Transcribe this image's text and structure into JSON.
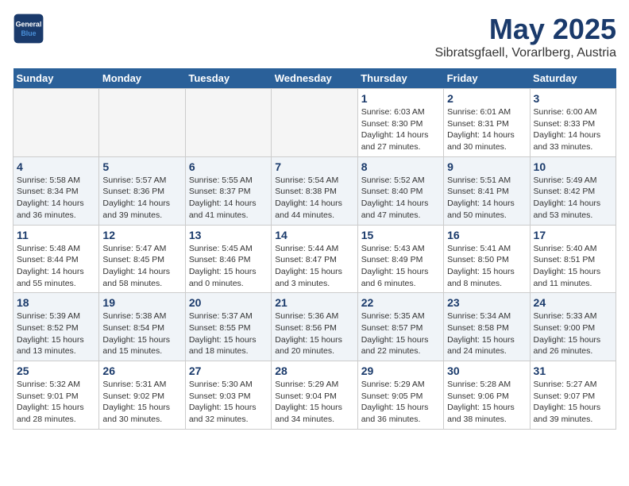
{
  "header": {
    "logo_text_general": "General",
    "logo_text_blue": "Blue",
    "month_title": "May 2025",
    "location": "Sibratsgfaell, Vorarlberg, Austria"
  },
  "weekdays": [
    "Sunday",
    "Monday",
    "Tuesday",
    "Wednesday",
    "Thursday",
    "Friday",
    "Saturday"
  ],
  "weeks": [
    [
      {
        "day": "",
        "info": ""
      },
      {
        "day": "",
        "info": ""
      },
      {
        "day": "",
        "info": ""
      },
      {
        "day": "",
        "info": ""
      },
      {
        "day": "1",
        "info": "Sunrise: 6:03 AM\nSunset: 8:30 PM\nDaylight: 14 hours\nand 27 minutes."
      },
      {
        "day": "2",
        "info": "Sunrise: 6:01 AM\nSunset: 8:31 PM\nDaylight: 14 hours\nand 30 minutes."
      },
      {
        "day": "3",
        "info": "Sunrise: 6:00 AM\nSunset: 8:33 PM\nDaylight: 14 hours\nand 33 minutes."
      }
    ],
    [
      {
        "day": "4",
        "info": "Sunrise: 5:58 AM\nSunset: 8:34 PM\nDaylight: 14 hours\nand 36 minutes."
      },
      {
        "day": "5",
        "info": "Sunrise: 5:57 AM\nSunset: 8:36 PM\nDaylight: 14 hours\nand 39 minutes."
      },
      {
        "day": "6",
        "info": "Sunrise: 5:55 AM\nSunset: 8:37 PM\nDaylight: 14 hours\nand 41 minutes."
      },
      {
        "day": "7",
        "info": "Sunrise: 5:54 AM\nSunset: 8:38 PM\nDaylight: 14 hours\nand 44 minutes."
      },
      {
        "day": "8",
        "info": "Sunrise: 5:52 AM\nSunset: 8:40 PM\nDaylight: 14 hours\nand 47 minutes."
      },
      {
        "day": "9",
        "info": "Sunrise: 5:51 AM\nSunset: 8:41 PM\nDaylight: 14 hours\nand 50 minutes."
      },
      {
        "day": "10",
        "info": "Sunrise: 5:49 AM\nSunset: 8:42 PM\nDaylight: 14 hours\nand 53 minutes."
      }
    ],
    [
      {
        "day": "11",
        "info": "Sunrise: 5:48 AM\nSunset: 8:44 PM\nDaylight: 14 hours\nand 55 minutes."
      },
      {
        "day": "12",
        "info": "Sunrise: 5:47 AM\nSunset: 8:45 PM\nDaylight: 14 hours\nand 58 minutes."
      },
      {
        "day": "13",
        "info": "Sunrise: 5:45 AM\nSunset: 8:46 PM\nDaylight: 15 hours\nand 0 minutes."
      },
      {
        "day": "14",
        "info": "Sunrise: 5:44 AM\nSunset: 8:47 PM\nDaylight: 15 hours\nand 3 minutes."
      },
      {
        "day": "15",
        "info": "Sunrise: 5:43 AM\nSunset: 8:49 PM\nDaylight: 15 hours\nand 6 minutes."
      },
      {
        "day": "16",
        "info": "Sunrise: 5:41 AM\nSunset: 8:50 PM\nDaylight: 15 hours\nand 8 minutes."
      },
      {
        "day": "17",
        "info": "Sunrise: 5:40 AM\nSunset: 8:51 PM\nDaylight: 15 hours\nand 11 minutes."
      }
    ],
    [
      {
        "day": "18",
        "info": "Sunrise: 5:39 AM\nSunset: 8:52 PM\nDaylight: 15 hours\nand 13 minutes."
      },
      {
        "day": "19",
        "info": "Sunrise: 5:38 AM\nSunset: 8:54 PM\nDaylight: 15 hours\nand 15 minutes."
      },
      {
        "day": "20",
        "info": "Sunrise: 5:37 AM\nSunset: 8:55 PM\nDaylight: 15 hours\nand 18 minutes."
      },
      {
        "day": "21",
        "info": "Sunrise: 5:36 AM\nSunset: 8:56 PM\nDaylight: 15 hours\nand 20 minutes."
      },
      {
        "day": "22",
        "info": "Sunrise: 5:35 AM\nSunset: 8:57 PM\nDaylight: 15 hours\nand 22 minutes."
      },
      {
        "day": "23",
        "info": "Sunrise: 5:34 AM\nSunset: 8:58 PM\nDaylight: 15 hours\nand 24 minutes."
      },
      {
        "day": "24",
        "info": "Sunrise: 5:33 AM\nSunset: 9:00 PM\nDaylight: 15 hours\nand 26 minutes."
      }
    ],
    [
      {
        "day": "25",
        "info": "Sunrise: 5:32 AM\nSunset: 9:01 PM\nDaylight: 15 hours\nand 28 minutes."
      },
      {
        "day": "26",
        "info": "Sunrise: 5:31 AM\nSunset: 9:02 PM\nDaylight: 15 hours\nand 30 minutes."
      },
      {
        "day": "27",
        "info": "Sunrise: 5:30 AM\nSunset: 9:03 PM\nDaylight: 15 hours\nand 32 minutes."
      },
      {
        "day": "28",
        "info": "Sunrise: 5:29 AM\nSunset: 9:04 PM\nDaylight: 15 hours\nand 34 minutes."
      },
      {
        "day": "29",
        "info": "Sunrise: 5:29 AM\nSunset: 9:05 PM\nDaylight: 15 hours\nand 36 minutes."
      },
      {
        "day": "30",
        "info": "Sunrise: 5:28 AM\nSunset: 9:06 PM\nDaylight: 15 hours\nand 38 minutes."
      },
      {
        "day": "31",
        "info": "Sunrise: 5:27 AM\nSunset: 9:07 PM\nDaylight: 15 hours\nand 39 minutes."
      }
    ]
  ]
}
